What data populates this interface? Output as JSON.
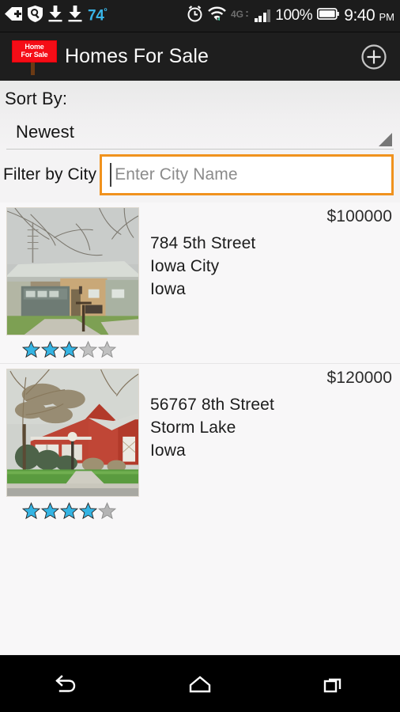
{
  "statusbar": {
    "icons": [
      "back-plus-icon",
      "shield-search-icon",
      "download-icon",
      "download-icon"
    ],
    "temperature": "74",
    "temperature_unit": "º",
    "alarm_icon": "alarm-clock-icon",
    "wifi_icon": "wifi-icon",
    "network_label": "4G",
    "signal_icon": "signal-bars-icon",
    "battery_percent": "100%",
    "battery_icon": "battery-full-icon",
    "time": "9:40",
    "am_pm": "PM",
    "accent_blue": "#39b5e8",
    "background": "#1c1c1c"
  },
  "actionbar": {
    "logo_line1": "Home",
    "logo_line2": "For Sale",
    "logo_color": "#f50d17",
    "title": "Homes For Sale",
    "add_button_icon": "plus-circle-icon",
    "background": "#1e1e1e"
  },
  "sort": {
    "label": "Sort By:",
    "selected": "Newest",
    "options": [
      "Newest"
    ],
    "dropdown_icon": "dropdown-triangle-icon"
  },
  "filter": {
    "label": "Filter by City",
    "placeholder": "Enter City Name",
    "value": "",
    "focus_color": "#f0921e"
  },
  "listings": [
    {
      "price": "$100000",
      "street": "784 5th Street",
      "city": "Iowa City",
      "state": "Iowa",
      "rating": 3,
      "max_rating": 5,
      "photo": "house-photo-tan-brick-ranch"
    },
    {
      "price": "$120000",
      "street": "56767 8th Street",
      "city": "Storm Lake",
      "state": "Iowa",
      "rating": 4,
      "max_rating": 5,
      "photo": "house-photo-red-sided-house"
    }
  ],
  "rating_colors": {
    "filled": "#35b4e3",
    "empty": "#9d9d9d"
  },
  "navbar": {
    "back_icon": "back-arrow-icon",
    "home_icon": "home-icon",
    "recents_icon": "recent-apps-icon",
    "background": "#000000"
  }
}
